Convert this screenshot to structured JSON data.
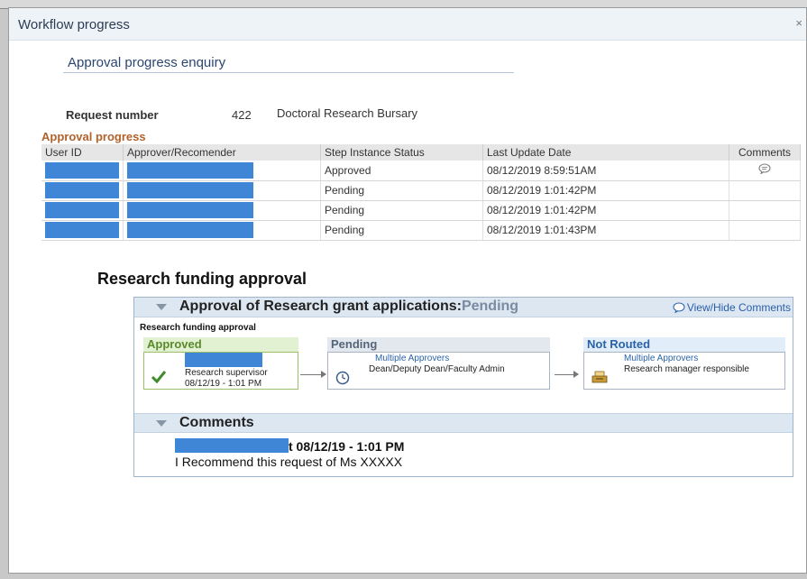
{
  "window": {
    "title": "Workflow progress",
    "close_label": "×"
  },
  "page": {
    "title": "Approval progress enquiry"
  },
  "request": {
    "label": "Request number",
    "number": "422",
    "description": "Doctoral Research Bursary"
  },
  "approval_progress": {
    "title": "Approval progress",
    "headers": {
      "user_id": "User ID",
      "approver": "Approver/Recomender",
      "status": "Step Instance Status",
      "date": "Last Update Date",
      "comments": "Comments"
    },
    "rows": [
      {
        "status": "Approved",
        "date": "08/12/2019  8:59:51AM",
        "has_comment": true
      },
      {
        "status": "Pending",
        "date": "08/12/2019  1:01:42PM",
        "has_comment": false
      },
      {
        "status": "Pending",
        "date": "08/12/2019  1:01:42PM",
        "has_comment": false
      },
      {
        "status": "Pending",
        "date": "08/12/2019  1:01:43PM",
        "has_comment": false
      }
    ]
  },
  "workflow": {
    "section_title": "Research funding approval",
    "header_title": "Approval of Research grant applications:",
    "header_status": "Pending",
    "view_hide_label": "View/Hide Comments",
    "subtitle": "Research funding approval",
    "stages": [
      {
        "state": "Approved",
        "line1": "Research supervisor",
        "line2": "08/12/19 - 1:01 PM",
        "icon": "checkmark-icon"
      },
      {
        "state": "Pending",
        "line1": "Multiple Approvers",
        "line2": "Dean/Deputy Dean/Faculty Admin",
        "icon": "clock-icon"
      },
      {
        "state": "Not Routed",
        "line1": "Multiple Approvers",
        "line2": "Research manager responsible",
        "icon": "inbox-tray-icon"
      }
    ],
    "comments": {
      "title": "Comments",
      "author_suffix": "t 08/12/19 - 1:01 PM",
      "text": "I Recommend this request of Ms XXXXX"
    }
  },
  "colors": {
    "redaction": "#3f86d6",
    "accent_orange": "#b1622b",
    "approved_green": "#5a8a2a",
    "link_blue": "#2a5fa8"
  }
}
